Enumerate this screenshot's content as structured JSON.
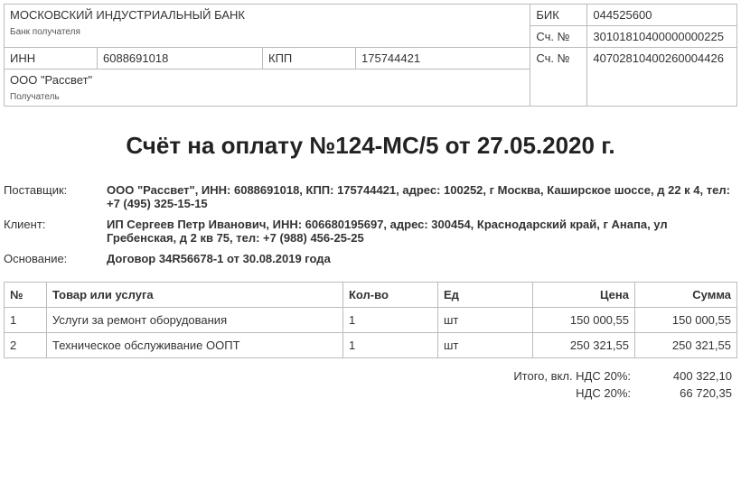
{
  "bank": {
    "name": "МОСКОВСКИЙ ИНДУСТРИАЛЬНЫЙ БАНК",
    "recipient_bank_label": "Банк получателя",
    "inn_label": "ИНН",
    "inn": "6088691018",
    "kpp_label": "КПП",
    "kpp": "175744421",
    "recipient_name": "ООО \"Рассвет\"",
    "recipient_label": "Получатель",
    "bik_label": "БИК",
    "bik": "044525600",
    "corr_acc_label": "Сч. №",
    "corr_acc": "30101810400000000225",
    "acc_label": "Сч. №",
    "acc": "40702810400260004426"
  },
  "title": "Счёт на оплату №124-МС/5 от 27.05.2020 г.",
  "parties": {
    "supplier_label": "Поставщик:",
    "supplier": "ООО \"Рассвет\", ИНН: 6088691018, КПП: 175744421, адрес: 100252, г Москва, Каширское шоссе, д 22 к 4, тел: +7 (495) 325-15-15",
    "client_label": "Клиент:",
    "client": "ИП Сергеев Петр Иванович, ИНН: 606680195697, адрес: 300454, Краснодарский край, г Анапа, ул Гребенская, д 2 кв 75, тел: +7 (988) 456-25-25",
    "basis_label": "Основание:",
    "basis": "Договор 34R56678-1 от 30.08.2019 года"
  },
  "items_header": {
    "num": "№",
    "name": "Товар или услуга",
    "qty": "Кол-во",
    "unit": "Ед",
    "price": "Цена",
    "sum": "Сумма"
  },
  "items": [
    {
      "num": "1",
      "name": "Услуги за ремонт оборудования",
      "qty": "1",
      "unit": "шт",
      "price": "150 000,55",
      "sum": "150 000,55"
    },
    {
      "num": "2",
      "name": "Техническое обслуживание ООПТ",
      "qty": "1",
      "unit": "шт",
      "price": "250 321,55",
      "sum": "250 321,55"
    }
  ],
  "totals": {
    "total_label": "Итого, вкл. НДС 20%:",
    "total": "400 322,10",
    "vat_label": "НДС 20%:",
    "vat": "66 720,35"
  }
}
